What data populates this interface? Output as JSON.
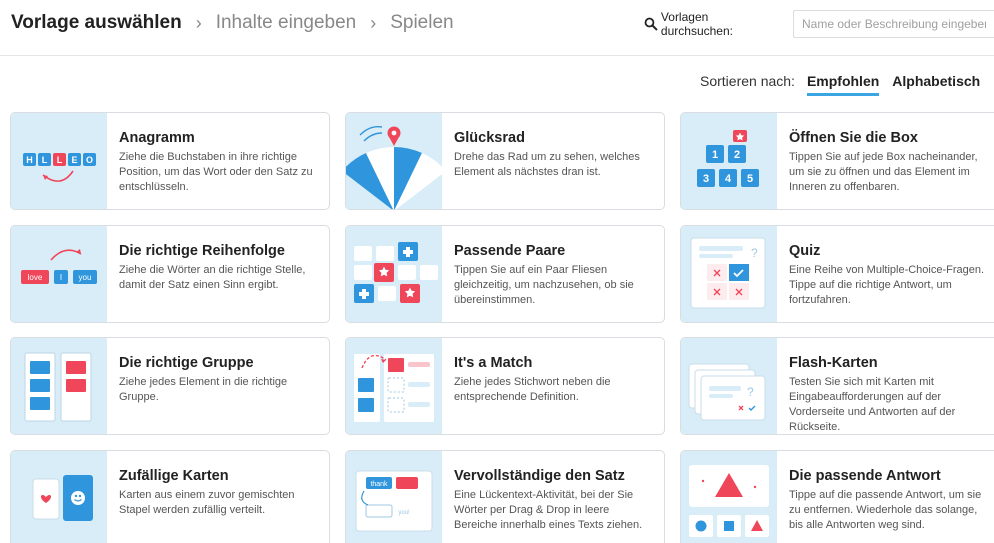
{
  "breadcrumb": {
    "step1": "Vorlage auswählen",
    "step2": "Inhalte eingeben",
    "step3": "Spielen",
    "separator": "›"
  },
  "search": {
    "label": "Vorlagen durchsuchen:",
    "placeholder": "Name oder Beschreibung eingeben",
    "icon": "search-icon"
  },
  "sort": {
    "label": "Sortieren nach:",
    "options": [
      "Empfohlen",
      "Alphabetisch"
    ],
    "selected": "Empfohlen",
    "accent": "#3aa5e0"
  },
  "templates": [
    {
      "title": "Anagramm",
      "desc": "Ziehe die Buchstaben in ihre richtige Position, um das Wort oder den Satz zu entschlüsseln.",
      "icon": "anagram-icon",
      "letters": [
        "H",
        "L",
        "L",
        "E",
        "O"
      ]
    },
    {
      "title": "Glücksrad",
      "desc": "Drehe das Rad um zu sehen, welches Element als nächstes dran ist.",
      "icon": "wheel-icon"
    },
    {
      "title": "Öffnen Sie die Box",
      "desc": "Tippen Sie auf jede Box nacheinander, um sie zu öffnen und das Element im Inneren zu offenbaren.",
      "icon": "boxes-icon",
      "numbers": [
        "1",
        "2",
        "3",
        "4",
        "5"
      ]
    },
    {
      "title": "Die richtige Reihenfolge",
      "desc": "Ziehe die Wörter an die richtige Stelle, damit der Satz einen Sinn ergibt.",
      "icon": "order-icon",
      "words": [
        "love",
        "I",
        "you"
      ]
    },
    {
      "title": "Passende Paare",
      "desc": "Tippen Sie auf ein Paar Fliesen gleichzeitig, um nachzusehen, ob sie übereinstimmen.",
      "icon": "pairs-icon"
    },
    {
      "title": "Quiz",
      "desc": "Eine Reihe von Multiple-Choice-Fragen. Tippe auf die richtige Antwort, um fortzufahren.",
      "icon": "quiz-icon"
    },
    {
      "title": "Die richtige Gruppe",
      "desc": "Ziehe jedes Element in die richtige Gruppe.",
      "icon": "group-icon"
    },
    {
      "title": "It's a Match",
      "desc": "Ziehe jedes Stichwort neben die entsprechende Definition.",
      "icon": "match-icon"
    },
    {
      "title": "Flash-Karten",
      "desc": "Testen Sie sich mit Karten mit Eingabeaufforderungen auf der Vorderseite und Antworten auf der Rückseite.",
      "icon": "flashcards-icon"
    },
    {
      "title": "Zufällige Karten",
      "desc": "Karten aus einem zuvor gemischten Stapel werden zufällig verteilt.",
      "icon": "random-cards-icon"
    },
    {
      "title": "Vervollständige den Satz",
      "desc": "Eine Lückentext-Aktivität, bei der Sie Wörter per Drag & Drop in leere Bereiche innerhalb eines Texts ziehen.",
      "icon": "complete-sentence-icon",
      "words": [
        "thank",
        "you!"
      ]
    },
    {
      "title": "Die passende Antwort",
      "desc": "Tippe auf die passende Antwort, um sie zu entfernen. Wiederhole das solange, bis alle Antworten weg sind.",
      "icon": "matching-answer-icon"
    }
  ],
  "colors": {
    "thumb_bg": "#d8edf8",
    "blue": "#2f95dc",
    "red": "#f0465a"
  }
}
